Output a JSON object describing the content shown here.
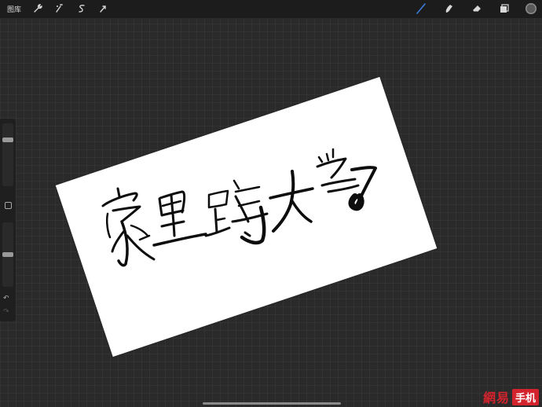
{
  "app": {
    "gallery_label": "图库"
  },
  "toolbar": {
    "left_tools": [
      "wrench-icon",
      "magic-wand-icon",
      "selection-s-icon",
      "transform-arrow-icon"
    ],
    "right_tools": [
      "brush-icon",
      "smudge-icon",
      "eraser-icon",
      "layers-icon"
    ],
    "active_tool": "brush-icon",
    "active_color": "#3a7bd5",
    "current_color": "#5a5a5a"
  },
  "sidebar": {
    "brush_size_level": 0.12,
    "opacity_level": 0.5,
    "undo_glyph": "↶",
    "redo_glyph": "↷"
  },
  "canvas": {
    "background": "#2a2a2a",
    "paper_color": "#ffffff",
    "ink_color": "#0d0d0d",
    "handwriting": "家里蹲大学"
  },
  "watermark": {
    "part1": "網易",
    "part2": "手机",
    "color": "#d3232d"
  }
}
